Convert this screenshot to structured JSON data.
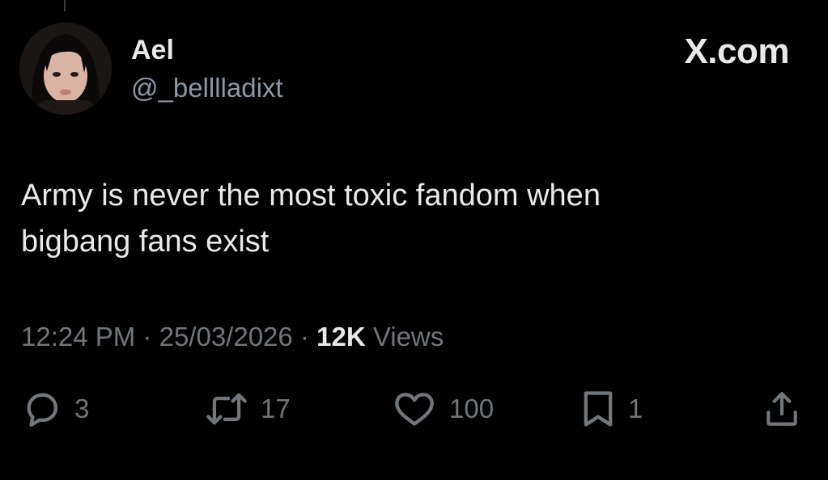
{
  "author": {
    "display_name": "Ael",
    "handle": "@_belllladixt"
  },
  "brand": {
    "label": "X.com"
  },
  "tweet": {
    "lines": [
      "Army is never the most toxic fandom when",
      "bigbang fans exist"
    ]
  },
  "meta": {
    "time": "12:24 PM",
    "separator": "·",
    "date": "25/03/2026",
    "views_count": "12K",
    "views_label": "Views"
  },
  "actions": {
    "reply": {
      "icon": "reply-icon",
      "count": "3"
    },
    "retweet": {
      "icon": "retweet-icon",
      "count": "17"
    },
    "like": {
      "icon": "heart-icon",
      "count": "100"
    },
    "bookmark": {
      "icon": "bookmark-icon",
      "count": "1"
    },
    "share": {
      "icon": "share-icon"
    }
  },
  "colors": {
    "background": "#000000",
    "primary_text": "#e7e9ea",
    "secondary_text": "#71767b"
  }
}
